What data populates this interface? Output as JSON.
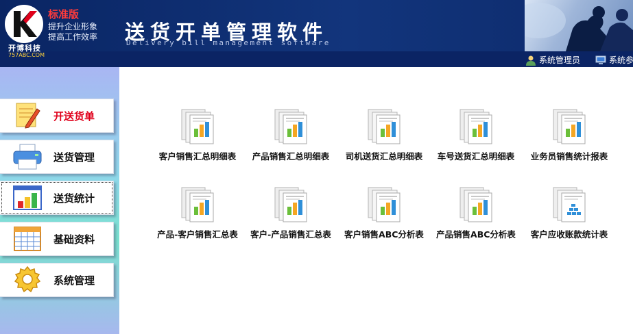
{
  "header": {
    "logo_letter": "K",
    "logo_company": "开博科技",
    "logo_url": "757ABC.COM",
    "edition": "标准版",
    "slogan_line1": "提升企业形象",
    "slogan_line2": "提高工作效率",
    "title": "送货开单管理软件",
    "subtitle": "Delivery bill management software",
    "user_label": "系统管理员",
    "settings_label": "系统参"
  },
  "sidebar": {
    "items": [
      {
        "label": "开送货单",
        "icon": "notepad-pencil-icon",
        "label_color": "#e0001b"
      },
      {
        "label": "送货管理",
        "icon": "printer-icon"
      },
      {
        "label": "送货统计",
        "icon": "bar-chart-icon",
        "active": true
      },
      {
        "label": "基础资料",
        "icon": "spreadsheet-icon"
      },
      {
        "label": "系统管理",
        "icon": "gear-icon"
      }
    ]
  },
  "reports": [
    {
      "label": "客户销售汇总明细表",
      "icon": "report-chart-icon"
    },
    {
      "label": "产品销售汇总明细表",
      "icon": "report-chart-icon"
    },
    {
      "label": "司机送货汇总明细表",
      "icon": "report-chart-icon"
    },
    {
      "label": "车号送货汇总明细表",
      "icon": "report-chart-icon"
    },
    {
      "label": "业务员销售统计报表",
      "icon": "report-chart-icon"
    },
    {
      "label": "产品-客户销售汇总表",
      "icon": "report-chart-icon"
    },
    {
      "label": "客户-产品销售汇总表",
      "icon": "report-chart-icon"
    },
    {
      "label": "客户销售ABC分析表",
      "icon": "report-chart-icon"
    },
    {
      "label": "产品销售ABC分析表",
      "icon": "report-chart-icon"
    },
    {
      "label": "客户应收账款统计表",
      "icon": "report-stack-icon"
    }
  ],
  "colors": {
    "header_bg": "#0d2a6b",
    "accent_red": "#e0001b",
    "edition_red": "#ff3b3b",
    "chart_green": "#6bbf3a",
    "chart_orange": "#f5a623",
    "chart_blue": "#2f8fd8"
  }
}
